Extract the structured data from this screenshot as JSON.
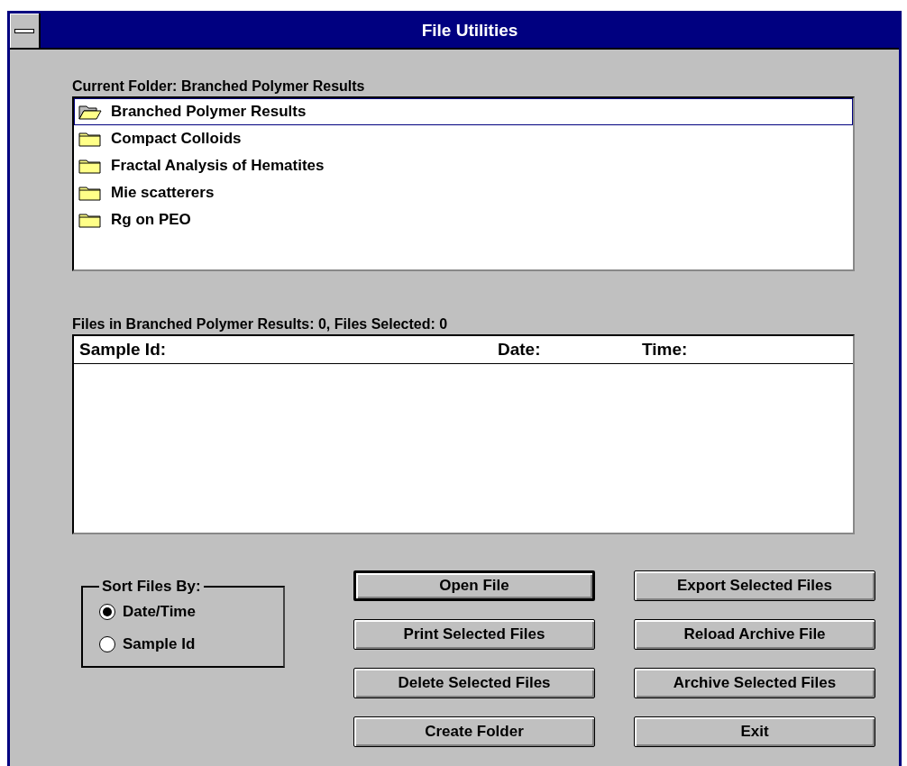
{
  "window": {
    "title": "File Utilities"
  },
  "folders": {
    "label": "Current Folder: Branched Polymer Results",
    "items": [
      {
        "name": "Branched Polymer Results",
        "selected": true
      },
      {
        "name": "Compact Colloids",
        "selected": false
      },
      {
        "name": "Fractal Analysis of Hematites",
        "selected": false
      },
      {
        "name": "Mie scatterers",
        "selected": false
      },
      {
        "name": "Rg on PEO",
        "selected": false
      }
    ]
  },
  "files": {
    "label": "Files in Branched Polymer Results: 0, Files Selected: 0",
    "columns": [
      "Sample Id:",
      "Date:",
      "Time:"
    ]
  },
  "sort": {
    "label": "Sort Files By:",
    "options": [
      {
        "label": "Date/Time",
        "selected": true
      },
      {
        "label": "Sample Id",
        "selected": false
      }
    ]
  },
  "buttons": [
    {
      "label": "Open File",
      "default": true
    },
    {
      "label": "Export Selected Files",
      "default": false
    },
    {
      "label": "Print Selected Files",
      "default": false
    },
    {
      "label": "Reload Archive File",
      "default": false
    },
    {
      "label": "Delete Selected Files",
      "default": false
    },
    {
      "label": "Archive Selected Files",
      "default": false
    },
    {
      "label": "Create Folder",
      "default": false
    },
    {
      "label": "Exit",
      "default": false
    }
  ]
}
